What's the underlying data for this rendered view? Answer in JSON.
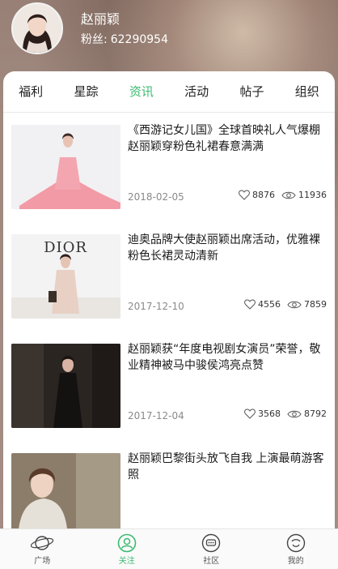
{
  "profile": {
    "name": "赵丽颖",
    "fans_label": "粉丝:",
    "fans_count": "62290954"
  },
  "tabs": [
    {
      "label": "福利",
      "active": false
    },
    {
      "label": "星踪",
      "active": false
    },
    {
      "label": "资讯",
      "active": true
    },
    {
      "label": "活动",
      "active": false
    },
    {
      "label": "帖子",
      "active": false
    },
    {
      "label": "组织",
      "active": false
    }
  ],
  "articles": [
    {
      "title": "《西游记女儿国》全球首映礼人气爆棚 赵丽颖穿粉色礼裙春意满满",
      "date": "2018-02-05",
      "likes": "8876",
      "views": "11936"
    },
    {
      "title": "迪奥品牌大使赵丽颖出席活动，优雅裸粉色长裙灵动清新",
      "date": "2017-12-10",
      "likes": "4556",
      "views": "7859"
    },
    {
      "title": "赵丽颖获“年度电视剧女演员”荣誉，敬业精神被马中骏侯鸿亮点赞",
      "date": "2017-12-04",
      "likes": "3568",
      "views": "8792"
    },
    {
      "title": "赵丽颖巴黎街头放飞自我 上演最萌游客照",
      "date": "",
      "likes": "",
      "views": ""
    }
  ],
  "thumb_text": {
    "dior": "DIOR"
  },
  "bottom_nav": [
    {
      "label": "广场",
      "icon": "planet-icon"
    },
    {
      "label": "关注",
      "icon": "follow-icon"
    },
    {
      "label": "社区",
      "icon": "community-icon"
    },
    {
      "label": "我的",
      "icon": "profile-icon"
    }
  ],
  "colors": {
    "accent": "#3cba6f"
  }
}
